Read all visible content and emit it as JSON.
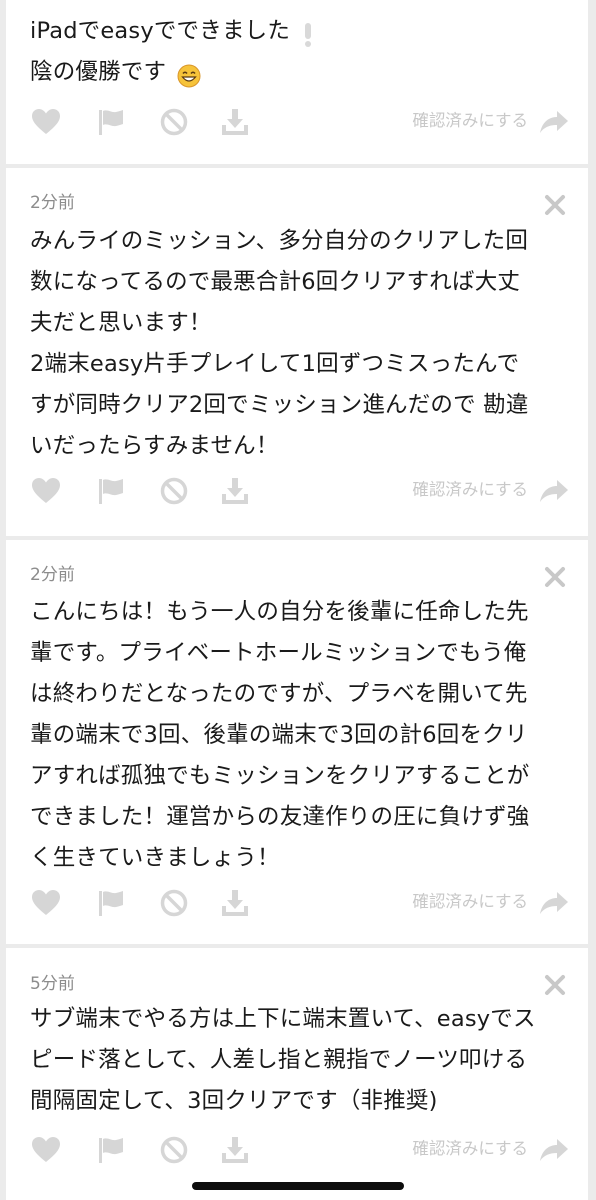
{
  "actions": {
    "confirm_label": "確認済みにする"
  },
  "comments": [
    {
      "time": "",
      "text": "iPadでeasyでできました\n陰の優勝です"
    },
    {
      "time": "2分前",
      "text": "みんライのミッション、多分自分のクリアした回\n数になってるので最悪合計6回クリアすれば大丈\n夫だと思います！\n2端末easy片手プレイして1回ずつミスったんで\nすが同時クリア2回でミッション進んだので 勘違\nいだったらすみません！"
    },
    {
      "time": "2分前",
      "text": "こんにちは！もう一人の自分を後輩に任命した先\n輩です。プライベートホールミッションでもう俺\nは終わりだとなったのですが、プラベを開いて先\n輩の端末で3回、後輩の端末で3回の計6回をクリ\nアすれば孤独でもミッションをクリアすることが\nできました！運営からの友達作りの圧に負けず強\nく生きていきましょう！"
    },
    {
      "time": "5分前",
      "text": "サブ端末でやる方は上下に端末置いて、easyでス\nピード落として、人差し指と親指でノーツ叩ける\n間隔固定して、3回クリアです（非推奨)"
    }
  ]
}
